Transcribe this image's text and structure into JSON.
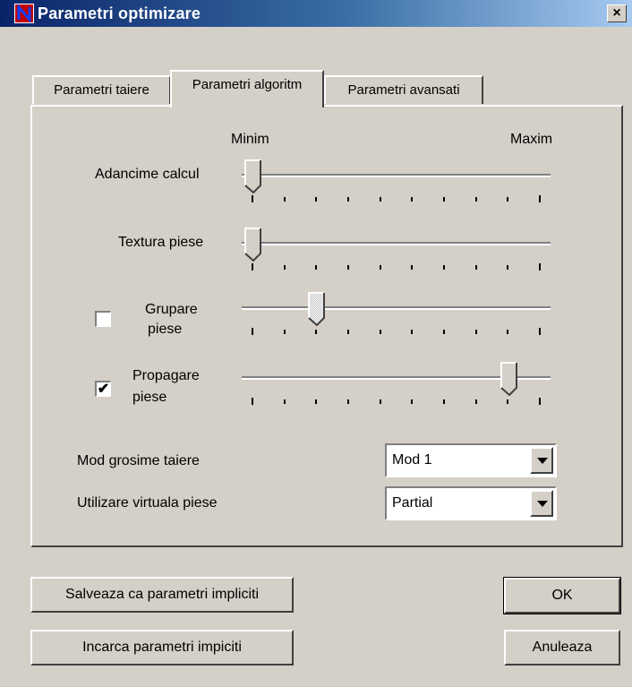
{
  "window": {
    "title": "Parametri optimizare",
    "close_glyph": "×"
  },
  "tabs": [
    {
      "label": "Parametri taiere",
      "active": false
    },
    {
      "label": "Parametri algoritm",
      "active": true
    },
    {
      "label": "Parametri avansati",
      "active": false
    }
  ],
  "scale": {
    "min_label": "Minim",
    "max_label": "Maxim"
  },
  "sliders": [
    {
      "label": "Adancime calcul",
      "value": 0,
      "ticks": 10,
      "has_checkbox": false
    },
    {
      "label": "Textura piese",
      "value": 0,
      "ticks": 10,
      "has_checkbox": false
    },
    {
      "label_line1": "Grupare",
      "label_line2": "piese",
      "value": 0.22,
      "ticks": 10,
      "has_checkbox": true,
      "checked": false,
      "enabled": false
    },
    {
      "label_line1": "Propagare",
      "label_line2": "piese",
      "value": 0.89,
      "ticks": 10,
      "has_checkbox": true,
      "checked": true,
      "enabled": true
    }
  ],
  "mod_grosime": {
    "label": "Mod grosime taiere",
    "value": "Mod 1"
  },
  "utilizare_virtuala": {
    "label": "Utilizare virtuala piese",
    "value": "Partial"
  },
  "buttons": {
    "save_defaults": "Salveaza ca parametri impliciti",
    "load_defaults": "Incarca parametri impiciti",
    "ok": "OK",
    "cancel": "Anuleaza"
  },
  "icons": {
    "app": "n-logo-icon",
    "checkmark": "✔"
  }
}
